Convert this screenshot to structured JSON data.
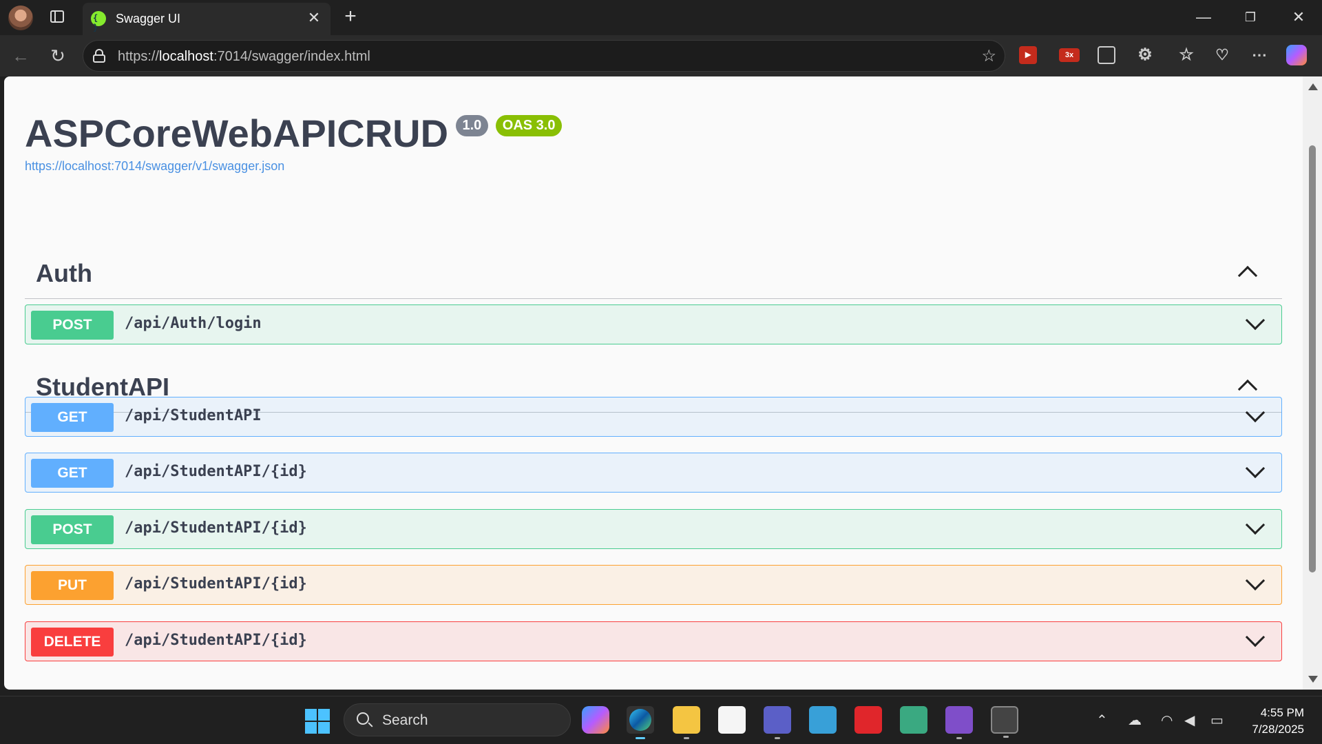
{
  "browser": {
    "tab_title": "Swagger UI",
    "url_prefix": "https://",
    "url_host": "localhost",
    "url_rest": ":7014/swagger/index.html"
  },
  "page": {
    "title": "ASPCoreWebAPICRUD",
    "version_badge": "1.0",
    "oas_badge": "OAS 3.0",
    "spec_url": "https://localhost:7014/swagger/v1/swagger.json",
    "colors": {
      "post": "#49cc90",
      "get": "#61affe",
      "put": "#fca130",
      "delete": "#f93e3e",
      "oas": "#89bf04",
      "version": "#7d8492"
    }
  },
  "tags": [
    {
      "name": "Auth",
      "operations": [
        {
          "method": "POST",
          "path": "/api/Auth/login"
        }
      ]
    },
    {
      "name": "StudentAPI",
      "operations": [
        {
          "method": "GET",
          "path": "/api/StudentAPI"
        },
        {
          "method": "GET",
          "path": "/api/StudentAPI/{id}"
        },
        {
          "method": "POST",
          "path": "/api/StudentAPI/{id}"
        },
        {
          "method": "PUT",
          "path": "/api/StudentAPI/{id}"
        },
        {
          "method": "DELETE",
          "path": "/api/StudentAPI/{id}"
        }
      ]
    }
  ],
  "extensions": {
    "ext2_label": "3x"
  },
  "taskbar": {
    "search_label": "Search",
    "time": "4:55 PM",
    "date": "7/28/2025"
  }
}
